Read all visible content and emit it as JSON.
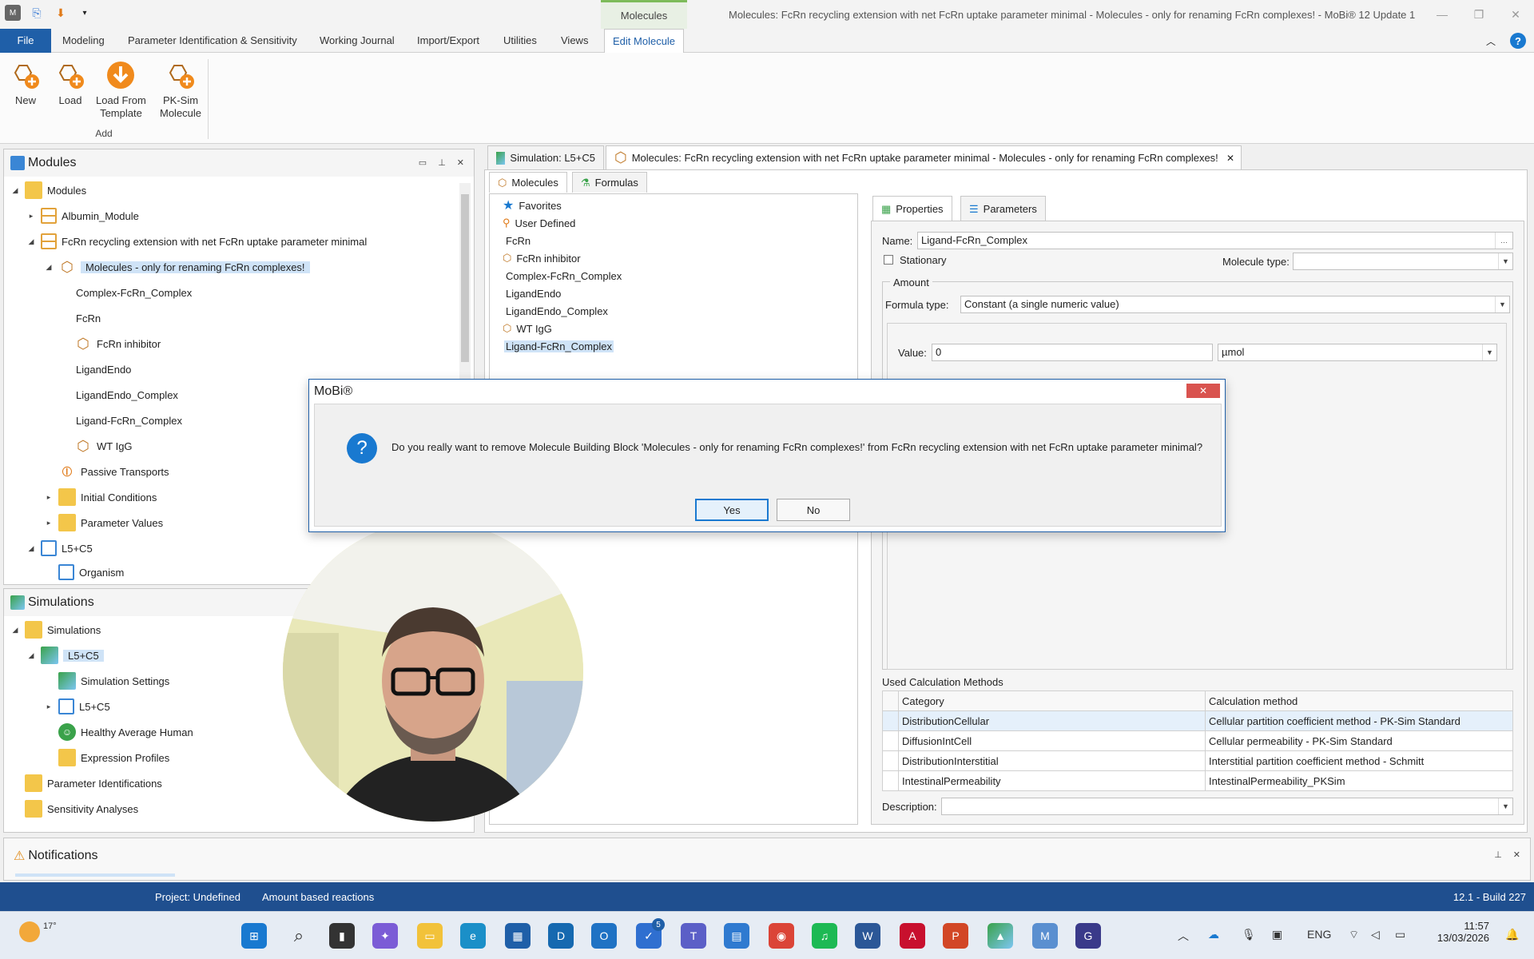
{
  "window": {
    "context_tab": "Molecules",
    "title": "Molecules: FcRn recycling extension with net FcRn uptake parameter minimal - Molecules - only for renaming FcRn complexes! - MoBi® 12 Update 1"
  },
  "ribbon": {
    "tabs": [
      "File",
      "Modeling",
      "Parameter Identification & Sensitivity",
      "Working Journal",
      "Import/Export",
      "Utilities",
      "Views",
      "Edit Molecule"
    ],
    "buttons": {
      "new": "New",
      "load": "Load",
      "load_template_1": "Load From",
      "load_template_2": "Template",
      "pksim_1": "PK-Sim",
      "pksim_2": "Molecule"
    },
    "group_add": "Add"
  },
  "modules_panel": {
    "title": "Modules",
    "tree": {
      "root": "Modules",
      "albumin": "Albumin_Module",
      "fcrn_module": "FcRn recycling extension with net FcRn uptake parameter minimal",
      "molecules_bb": "Molecules - only for renaming FcRn complexes!",
      "m1": "Complex-FcRn_Complex",
      "m2": "FcRn",
      "m3": "FcRn inhibitor",
      "m4": "LigandEndo",
      "m5": "LigandEndo_Complex",
      "m6": "Ligand-FcRn_Complex",
      "m7": "WT IgG",
      "passive": "Passive Transports",
      "initial": "Initial Conditions",
      "param_values": "Parameter Values",
      "l5c5": "L5+C5",
      "organism": "Organism"
    }
  },
  "simulations_panel": {
    "title": "Simulations",
    "tree": {
      "root": "Simulations",
      "sim": "L5+C5",
      "settings": "Simulation Settings",
      "sub": "L5+C5",
      "individual": "Healthy Average Human",
      "expression": "Expression Profiles",
      "param_ids": "Parameter Identifications",
      "sensitivity": "Sensitivity Analyses"
    }
  },
  "notifications": {
    "title": "Notifications"
  },
  "doc_tabs": {
    "tab1": "Simulation: L5+C5",
    "tab2": "Molecules: FcRn recycling extension with net FcRn uptake parameter minimal - Molecules - only for renaming FcRn complexes!"
  },
  "subtabs": {
    "molecules": "Molecules",
    "formulas": "Formulas",
    "properties": "Properties",
    "parameters": "Parameters"
  },
  "molecule_list": [
    "Favorites",
    "User Defined",
    "FcRn",
    "FcRn inhibitor",
    "Complex-FcRn_Complex",
    "LigandEndo",
    "LigandEndo_Complex",
    "WT IgG",
    "Ligand-FcRn_Complex"
  ],
  "properties": {
    "name_label": "Name:",
    "name_value": "Ligand-FcRn_Complex",
    "stationary_label": "Stationary",
    "molecule_type_label": "Molecule type:",
    "molecule_type_value": "",
    "amount_group": "Amount",
    "formula_type_label": "Formula type:",
    "formula_type_value": "Constant (a single numeric value)",
    "value_label": "Value:",
    "value": "0",
    "unit": "µmol",
    "calc_methods_title": "Used Calculation Methods",
    "calc_headers": [
      "Category",
      "Calculation method"
    ],
    "calc_rows": [
      [
        "DistributionCellular",
        "Cellular partition coefficient method - PK-Sim Standard"
      ],
      [
        "DiffusionIntCell",
        "Cellular permeability - PK-Sim Standard"
      ],
      [
        "DistributionInterstitial",
        "Interstitial partition coefficient method - Schmitt"
      ],
      [
        "IntestinalPermeability",
        "IntestinalPermeability_PKSim"
      ]
    ],
    "description_label": "Description:"
  },
  "dialog": {
    "title": "MoBi®",
    "message": "Do you really want to remove Molecule Building Block 'Molecules - only for renaming FcRn complexes!' from FcRn recycling extension with net FcRn uptake parameter minimal?",
    "yes": "Yes",
    "no": "No"
  },
  "status": {
    "project": "Project: Undefined",
    "reactions": "Amount based reactions",
    "build": "12.1 - Build 227"
  },
  "taskbar": {
    "weather": "17°",
    "lang": "ENG",
    "time": "11:57",
    "date": "13/03/2026",
    "todo_badge": "5"
  },
  "colors": {
    "accent": "#1f5fa8",
    "selection": "#cfe3f7",
    "status": "#1f4f8f"
  }
}
